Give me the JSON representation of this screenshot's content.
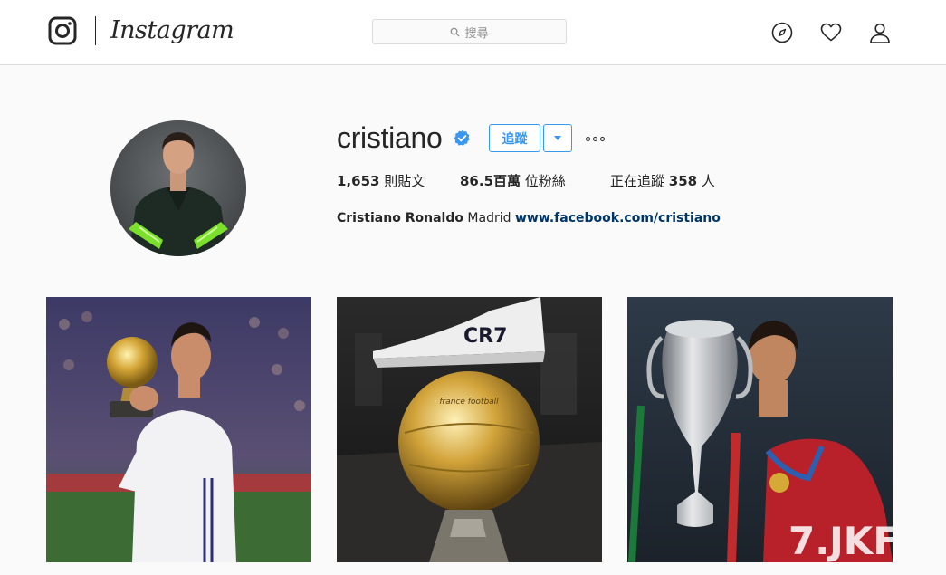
{
  "nav": {
    "logo_text": "Instagram",
    "search_placeholder": "搜尋",
    "icons": [
      "instagram-camera-icon",
      "compass-icon",
      "heart-icon",
      "person-icon"
    ]
  },
  "profile": {
    "username": "cristiano",
    "verified_icon": "verified-badge-icon",
    "follow_label": "追蹤",
    "posts_count": "1,653",
    "posts_label": "則貼文",
    "followers_count": "86.5百萬",
    "followers_label": "位粉絲",
    "following_prefix": "正在追蹤",
    "following_count": "358",
    "following_suffix": "人",
    "full_name": "Cristiano Ronaldo",
    "bio_text": "Madrid",
    "website": "www.facebook.com/cristiano"
  },
  "posts": [
    {
      "name": "post-ballon-dor-kiss"
    },
    {
      "name": "post-cr7-boot-golden-ball",
      "boot_text": "CR7",
      "ball_text": "france football"
    },
    {
      "name": "post-euro-trophy-kiss",
      "watermark": "7.JKF"
    }
  ],
  "colors": {
    "accent": "#3897f0",
    "link": "#003569",
    "text": "#262626",
    "border": "#dbdbdb"
  }
}
